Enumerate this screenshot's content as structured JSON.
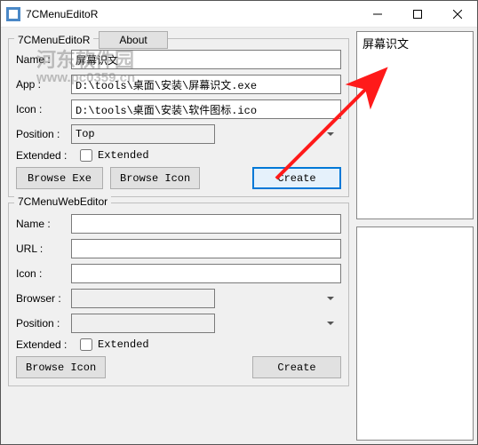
{
  "window": {
    "title": "7CMenuEditoR"
  },
  "watermark": {
    "line1": "河东软件园",
    "line2": "www.pc0359.cn"
  },
  "editor": {
    "legend": "7CMenuEditoR",
    "about": "About",
    "name_label": "Name :",
    "name_value": "屏幕识文",
    "app_label": "App :",
    "app_value": "D:\\tools\\桌面\\安装\\屏幕识文.exe",
    "icon_label": "Icon :",
    "icon_value": "D:\\tools\\桌面\\安装\\软件图标.ico",
    "position_label": "Position :",
    "position_value": "Top",
    "extended_label": "Extended :",
    "extended_checkbox_label": "Extended",
    "browse_exe": "Browse Exe",
    "browse_icon": "Browse Icon",
    "create": "Create"
  },
  "web": {
    "legend": "7CMenuWebEditor",
    "name_label": "Name :",
    "name_value": "",
    "url_label": "URL :",
    "url_value": "",
    "icon_label": "Icon :",
    "icon_value": "",
    "browser_label": "Browser :",
    "browser_value": "",
    "position_label": "Position :",
    "position_value": "",
    "extended_label": "Extended :",
    "extended_checkbox_label": "Extended",
    "browse_icon": "Browse Icon",
    "create": "Create"
  },
  "list": {
    "item1": "屏幕识文"
  }
}
